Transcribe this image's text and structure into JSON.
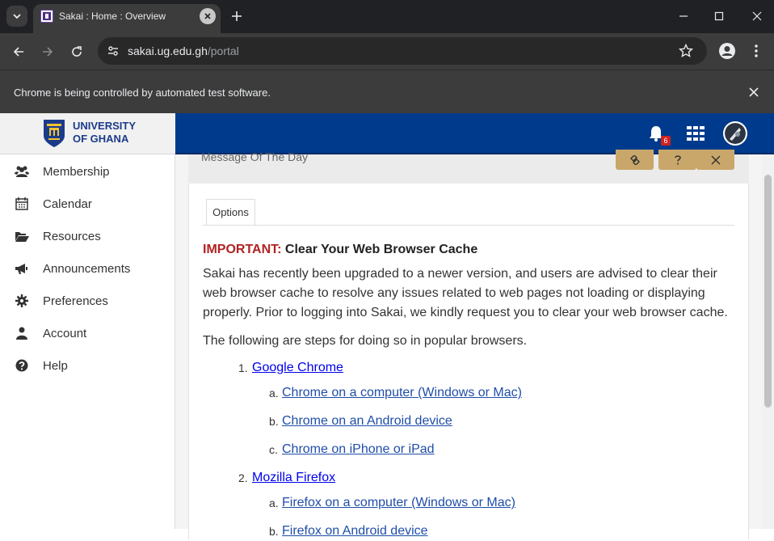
{
  "browser": {
    "tab_title": "Sakai : Home : Overview",
    "url_domain": "sakai.ug.edu.gh",
    "url_path": "/portal",
    "automation_notice": "Chrome is being controlled by automated test software."
  },
  "header": {
    "logo_line1": "UNIVERSITY",
    "logo_line2": "OF GHANA",
    "notification_count": "6",
    "colors": {
      "bar": "#003a8c",
      "badge": "#d0211f"
    }
  },
  "sidebar": {
    "items": [
      {
        "label": "Membership",
        "icon": "users-icon"
      },
      {
        "label": "Calendar",
        "icon": "calendar-icon"
      },
      {
        "label": "Resources",
        "icon": "folder-open-icon"
      },
      {
        "label": "Announcements",
        "icon": "bullhorn-icon"
      },
      {
        "label": "Preferences",
        "icon": "gear-icon"
      },
      {
        "label": "Account",
        "icon": "user-icon"
      },
      {
        "label": "Help",
        "icon": "question-circle-icon"
      }
    ]
  },
  "panel": {
    "title": "Message Of The Day",
    "tab_label": "Options",
    "important_prefix": "IMPORTANT:",
    "heading": " Clear Your Web Browser Cache",
    "paragraph1": "Sakai has recently been upgraded to a newer version, and users are advised to clear their web browser cache to resolve any issues related to web pages not loading or displaying properly. Prior to logging into Sakai, we kindly request you to clear your web browser cache.",
    "paragraph2": "The following are steps for doing so in popular browsers.",
    "browsers": [
      {
        "number": "1.",
        "name": "Google Chrome",
        "subitems": [
          {
            "letter": "a.",
            "text": "Chrome on a computer (Windows or Mac)"
          },
          {
            "letter": "b.",
            "text": "Chrome on an Android device"
          },
          {
            "letter": "c.",
            "text": "Chrome on iPhone or iPad"
          }
        ]
      },
      {
        "number": "2.",
        "name": "Mozilla Firefox",
        "subitems": [
          {
            "letter": "a.",
            "text": "Firefox on a computer (Windows or Mac)"
          },
          {
            "letter": "b.",
            "text": "Firefox on Android device"
          }
        ]
      }
    ]
  }
}
